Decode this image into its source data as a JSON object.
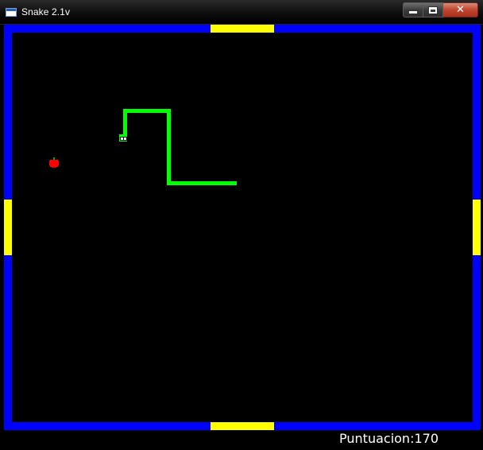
{
  "window": {
    "title": "Snake 2.1v",
    "close_glyph": "✕"
  },
  "icons": {
    "app": "window-app-icon",
    "minimize": "minimize-icon",
    "maximize": "maximize-icon",
    "close": "close-icon",
    "apple": "apple-icon"
  },
  "colors": {
    "wall": "#0000ff",
    "door": "#ffff00",
    "snake": "#00ff00",
    "apple": "#ff0000",
    "background": "#000000"
  },
  "game": {
    "score_text": "Puntuacion:170"
  }
}
